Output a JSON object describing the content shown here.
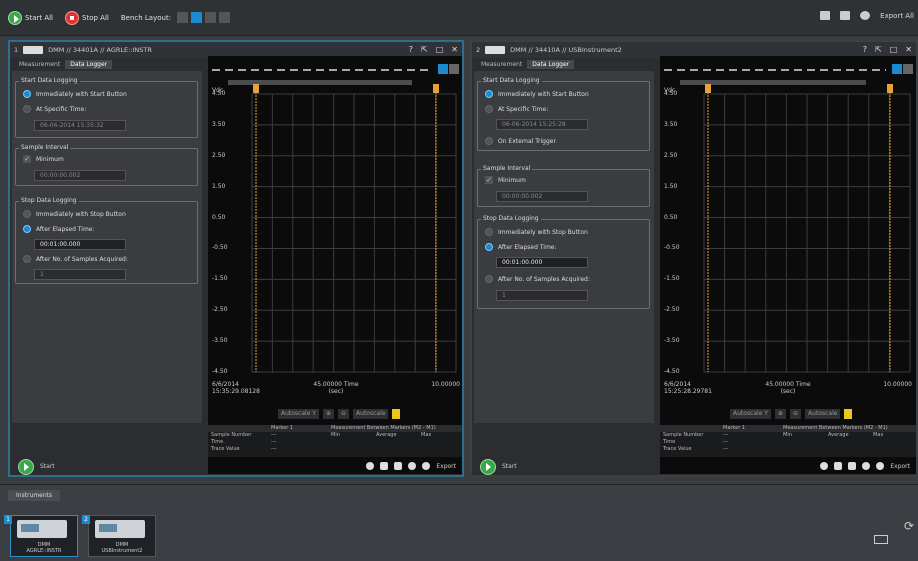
{
  "toolbar": {
    "start_all": "Start All",
    "stop_all": "Stop All",
    "bench_layout": "Bench Layout:",
    "export_all": "Export All"
  },
  "panels": [
    {
      "index": "1",
      "title": "DMM // 34401A // AGRLE::INSTR",
      "tabs": [
        "Measurement",
        "Data Logger"
      ],
      "start_group": "Start Data Logging",
      "start_opts": [
        "Immediately with Start Button",
        "At Specific Time:"
      ],
      "start_time": "06-06-2014 15:35:32",
      "sample_group": "Sample Interval",
      "minimum": "Minimum",
      "interval": "00:00:00.002",
      "stop_group": "Stop Data Logging",
      "stop_opts": [
        "Immediately with Stop Button",
        "After Elapsed Time:",
        "After No. of Samples Acquired:"
      ],
      "elapsed": "00:01:00.000",
      "samples": "1",
      "y_unit": "Vdc",
      "yticks": [
        "4.50",
        "3.50",
        "2.50",
        "1.50",
        "0.50",
        "-0.50",
        "-1.50",
        "-2.50",
        "-3.50",
        "-4.50"
      ],
      "x_left": "6/6/2014 15:35:29.08128",
      "x_mid": "45.00000 Time (sec)",
      "x_right": "10.00000",
      "autoscale_y": "Autoscale Y",
      "autoscale": "Autoscale",
      "table_marker": "Marker 1",
      "table_between": "Measurement Between Markers (M2 - M1)",
      "table_rows": [
        "Sample Number",
        "Time",
        "Trace Value"
      ],
      "table_cols": [
        "Min",
        "Average",
        "Max"
      ],
      "start": "Start",
      "export": "Export"
    },
    {
      "index": "2",
      "title": "DMM // 34410A // USBInstrument2",
      "tabs": [
        "Measurement",
        "Data Logger"
      ],
      "start_group": "Start Data Logging",
      "start_opts": [
        "Immediately with Start Button",
        "At Specific Time:",
        "On External Trigger"
      ],
      "start_time": "06-06-2014 15:25:28",
      "sample_group": "Sample Interval",
      "minimum": "Minimum",
      "interval": "00:00:00.002",
      "stop_group": "Stop Data Logging",
      "stop_opts": [
        "Immediately with Stop Button",
        "After Elapsed Time:",
        "After No. of Samples Acquired:"
      ],
      "elapsed": "00:01:00.000",
      "samples": "1",
      "y_unit": "Vdc",
      "yticks": [
        "4.50",
        "3.50",
        "2.50",
        "1.50",
        "0.50",
        "-0.50",
        "-1.50",
        "-2.50",
        "-3.50",
        "-4.50"
      ],
      "x_left": "6/6/2014 15:25:28.29781",
      "x_mid": "45.00000 Time (sec)",
      "x_right": "10.00000",
      "autoscale_y": "Autoscale Y",
      "autoscale": "Autoscale",
      "table_marker": "Marker 1",
      "table_between": "Measurement Between Markers (M2 - M1)",
      "table_rows": [
        "Sample Number",
        "Time",
        "Trace Value"
      ],
      "table_cols": [
        "Min",
        "Average",
        "Max"
      ],
      "start": "Start",
      "export": "Export"
    }
  ],
  "instruments": {
    "tab": "Instruments",
    "items": [
      {
        "badge": "1",
        "line1": "DMM",
        "line2": "AGRLE::INSTR"
      },
      {
        "badge": "2",
        "line1": "DMM",
        "line2": "USBInstrument2"
      }
    ]
  },
  "colors": {
    "accent": "#2e6f8e",
    "marker": "#e8a13a",
    "start_green": "#3aa84a",
    "stop_red": "#d33333"
  }
}
